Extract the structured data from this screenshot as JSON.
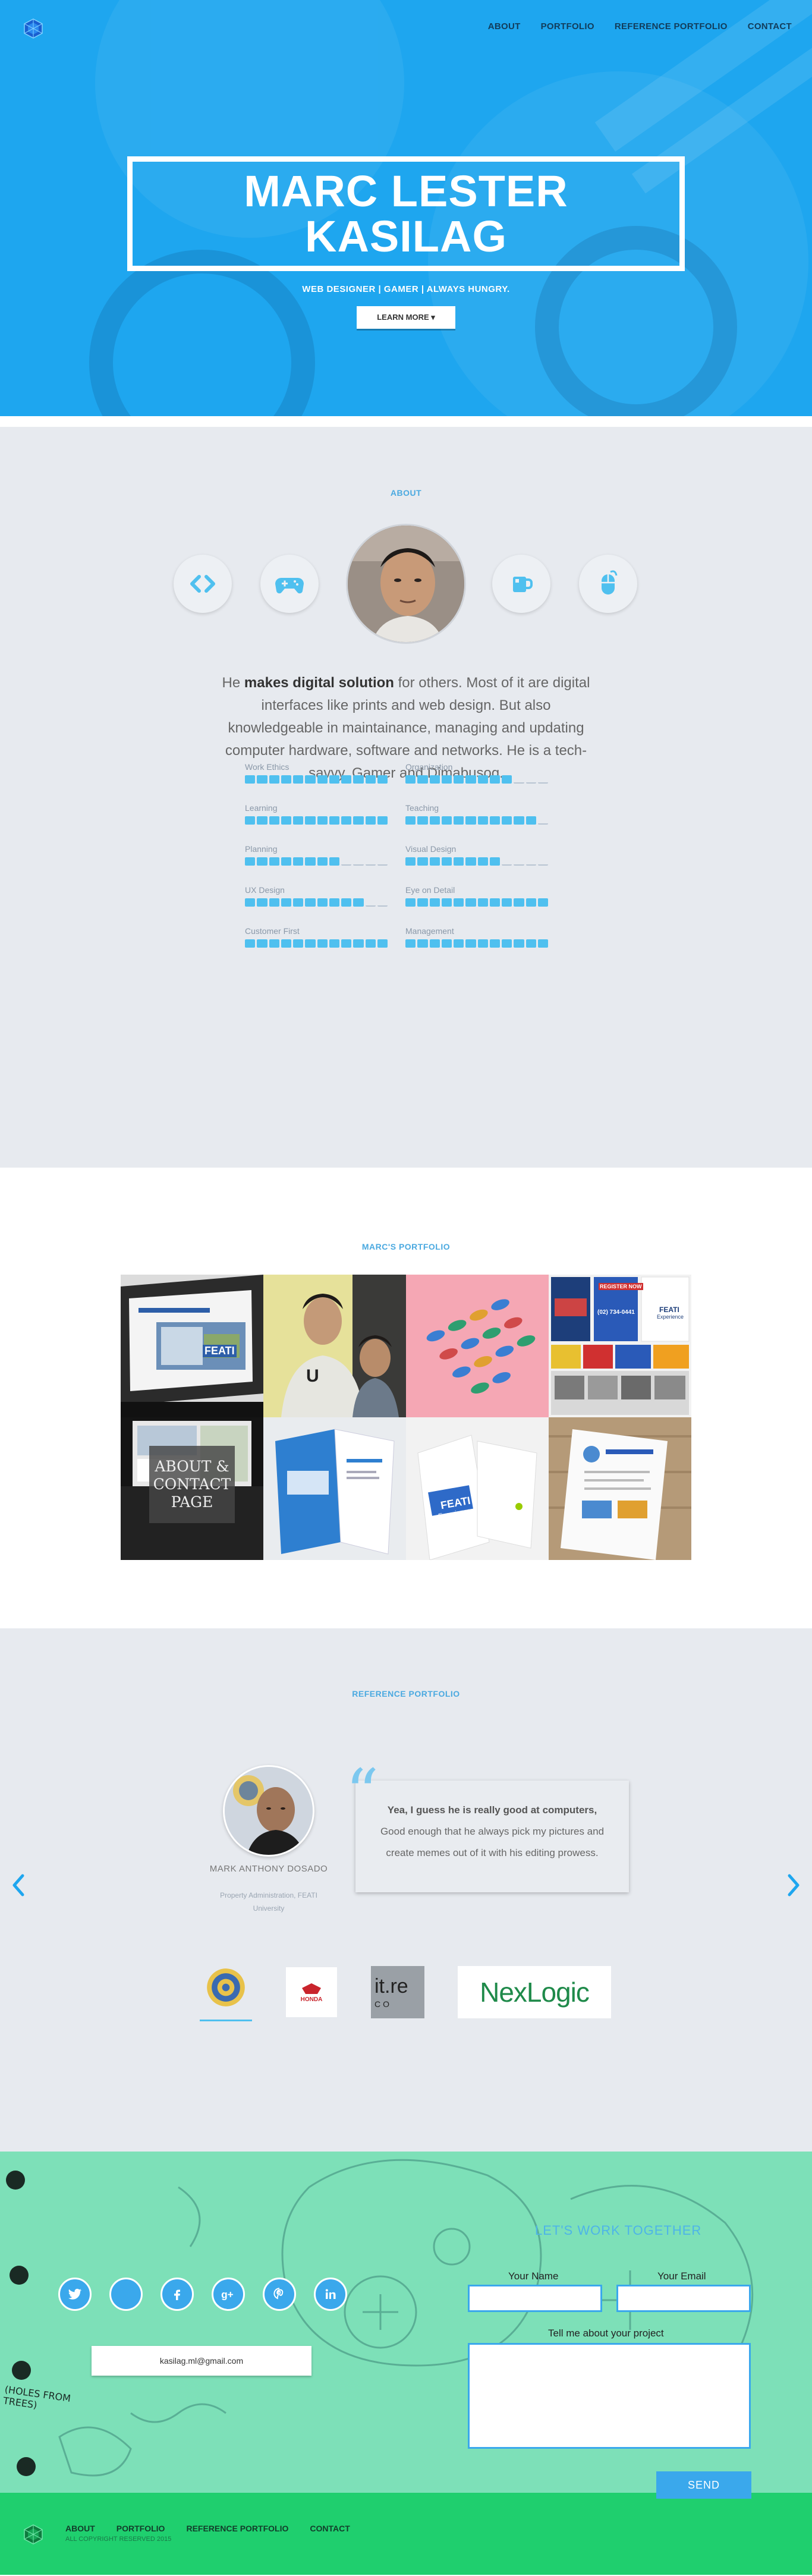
{
  "header": {
    "logo_icon": "blue-geometric-logo-icon",
    "nav": [
      "ABOUT",
      "PORTFOLIO",
      "REFERENCE PORTFOLIO",
      "CONTACT"
    ]
  },
  "hero": {
    "name_line1": "MARC LESTER",
    "name_line2": "KASILAG",
    "tagline": "WEB DESIGNER | GAMER | ALWAYS HUNGRY.",
    "cta_label": "LEARN MORE ▾"
  },
  "about": {
    "section_label": "ABOUT",
    "icons": [
      "code-icon",
      "gamepad-icon",
      "coffee-mug-icon",
      "mouse-icon"
    ],
    "bio_pre": "He ",
    "bio_bold": "makes digital solution",
    "bio_post": " for others. Most of it are digital interfaces like prints and web design. But also knowledgeable in maintainance, managing and updating computer hardware, software and networks. He is a tech-savvy, Gamer and Dimabusog.",
    "skills": [
      {
        "label": "Work Ethics",
        "filled": 12,
        "total": 12
      },
      {
        "label": "Organization",
        "filled": 9,
        "total": 12
      },
      {
        "label": "Learning",
        "filled": 12,
        "total": 12
      },
      {
        "label": "Teaching",
        "filled": 11,
        "total": 12
      },
      {
        "label": "Planning",
        "filled": 8,
        "total": 12
      },
      {
        "label": "Visual Design",
        "filled": 8,
        "total": 12
      },
      {
        "label": "UX Design",
        "filled": 10,
        "total": 12
      },
      {
        "label": "Eye on Detail",
        "filled": 12,
        "total": 12
      },
      {
        "label": "Customer First",
        "filled": 12,
        "total": 12
      },
      {
        "label": "Management",
        "filled": 12,
        "total": 12
      }
    ]
  },
  "portfolio": {
    "section_label": "MARC'S PORTFOLIO",
    "overlay_text": "ABOUT & CONTACT PAGE",
    "tile_texts": {
      "register_now": "REGISTER NOW",
      "phone_number": "(02) 734-0441",
      "feati": "FEATI",
      "experience": "Experience"
    }
  },
  "references": {
    "section_label": "REFERENCE PORTFOLIO",
    "name": "MARK ANTHONY DOSADO",
    "role": "Property Administration, FEATI University",
    "quote_bold": "Yea, I guess he is really good at computers,",
    "quote_rest": "Good enough that he always pick my pictures and create memes out of it with his editing prowess.",
    "clients": [
      "feati-seal-logo",
      "HONDA",
      "it.re",
      "NexLogic"
    ],
    "client_subtext": "CO"
  },
  "contact": {
    "title": "LET'S WORK TOGETHER",
    "social": [
      "twitter-icon",
      "blank-icon",
      "facebook-icon",
      "google-plus-icon",
      "pinterest-icon",
      "linkedin-icon"
    ],
    "email": "kasilag.ml@gmail.com",
    "name_label": "Your Name",
    "email_label": "Your Email",
    "message_label": "Tell me about your project",
    "send_label": "SEND",
    "doodle_text": "(HOLES FROM TREES)"
  },
  "footer": {
    "nav": [
      "ABOUT",
      "PORTFOLIO",
      "REFERENCE PORTFOLIO",
      "CONTACT"
    ],
    "copyright": "ALL COPYRIGHT RESERVED 2015"
  },
  "colors": {
    "hero_blue": "#1ea6ef",
    "accent_blue": "#4fc0ef",
    "section_grey": "#e7eaef",
    "contact_mint": "#7de0b8",
    "footer_green": "#1fcf6e"
  }
}
